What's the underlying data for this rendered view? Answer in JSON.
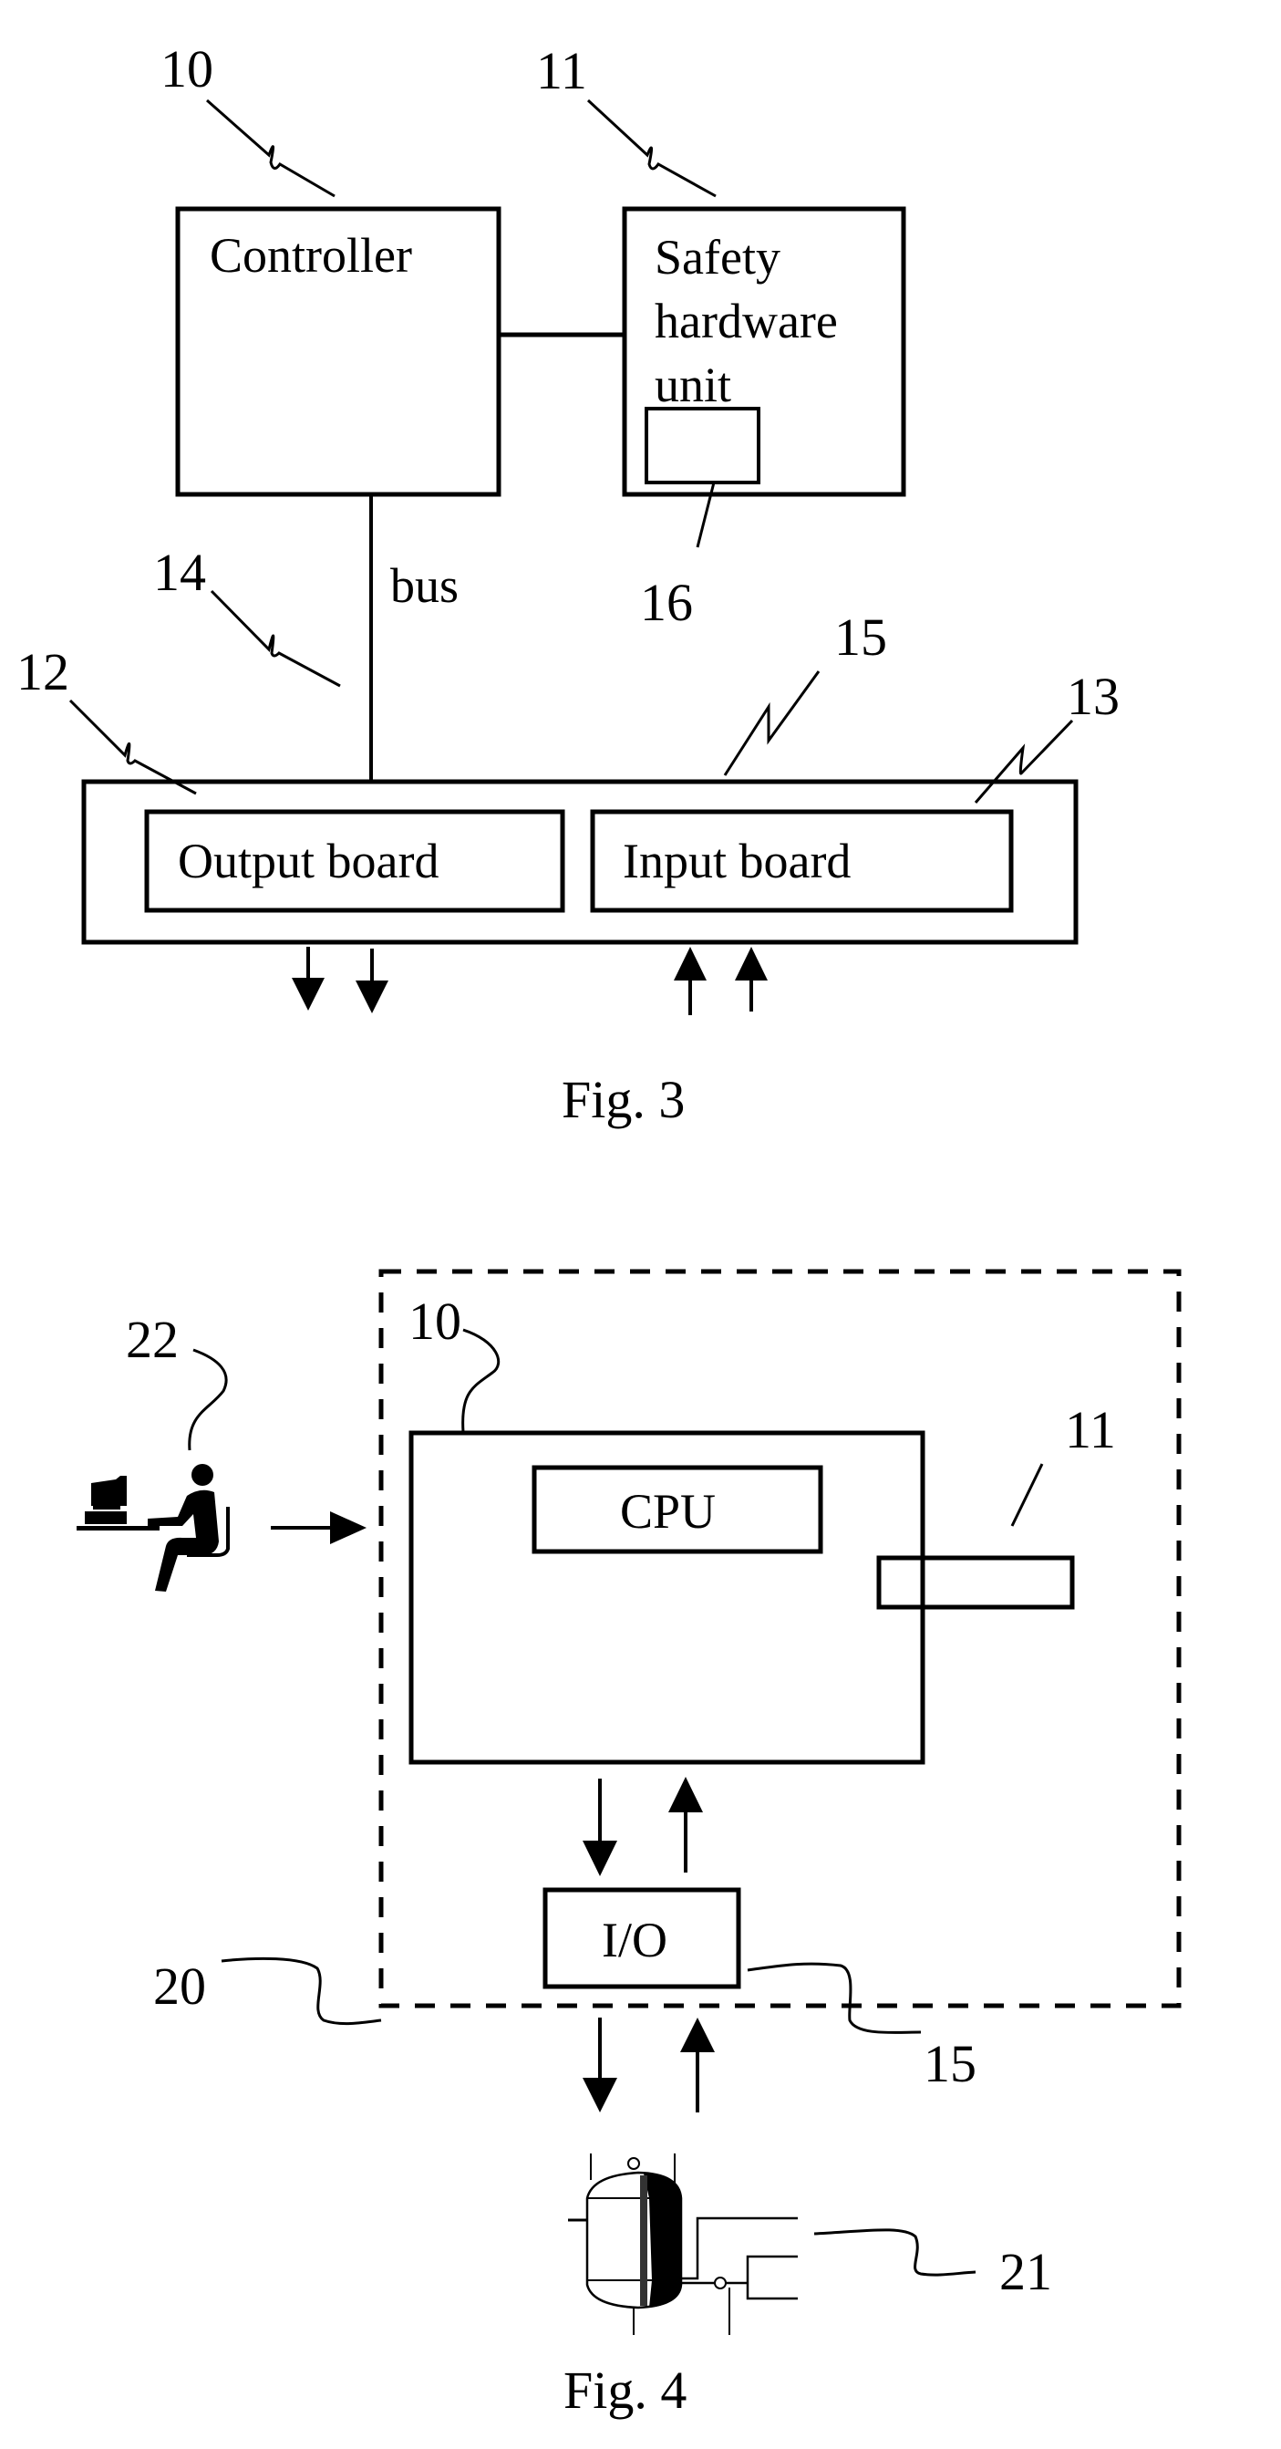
{
  "figures": {
    "fig3": {
      "caption": "Fig. 3",
      "controller": {
        "ref": "10",
        "label": "Controller"
      },
      "safety_unit": {
        "ref": "11",
        "label_lines": [
          "Safety",
          "hardware",
          "unit"
        ],
        "inner_ref": "16"
      },
      "bus": {
        "ref": "14",
        "label": "bus"
      },
      "io_unit": {
        "ref": "15"
      },
      "output_board": {
        "ref": "12",
        "label": "Output board"
      },
      "input_board": {
        "ref": "13",
        "label": "Input board"
      }
    },
    "fig4": {
      "caption": "Fig. 4",
      "system": {
        "ref": "20"
      },
      "controller": {
        "ref": "10"
      },
      "cpu": {
        "label": "CPU"
      },
      "safety_unit": {
        "ref": "11"
      },
      "io": {
        "ref": "15",
        "label": "I/O"
      },
      "operator": {
        "ref": "22",
        "icon": "operator-at-computer-icon"
      },
      "process": {
        "ref": "21",
        "icon": "process-vessel-icon"
      }
    }
  },
  "colors": {
    "ink": "#000000",
    "paper": "#ffffff"
  }
}
